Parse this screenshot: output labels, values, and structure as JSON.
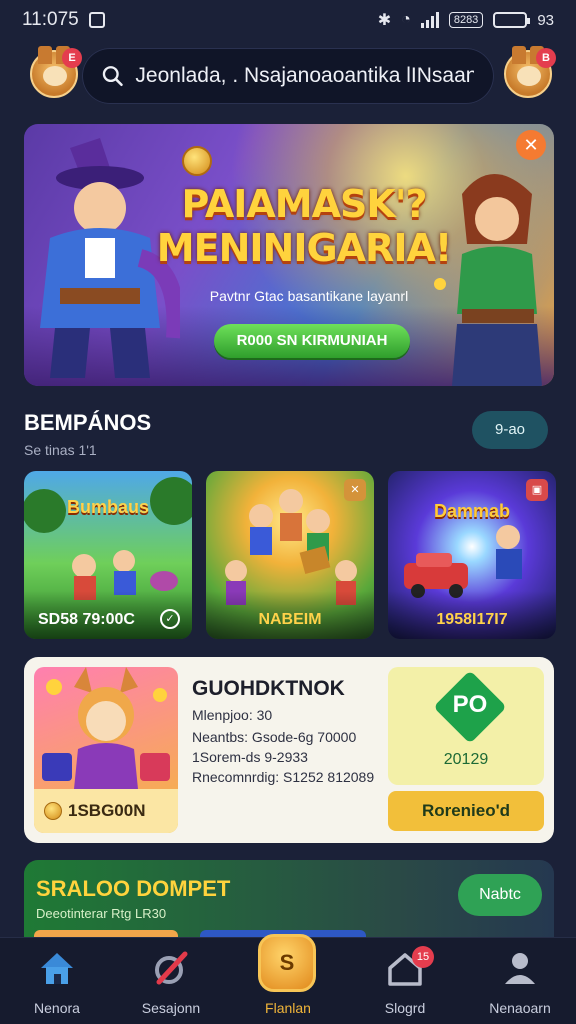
{
  "status_bar": {
    "time": "11:075",
    "battery_label": "8283",
    "battery_percent": "93"
  },
  "header": {
    "search_text": "Jeonlada, . Nsajanoaoantika lINsaan.",
    "left_badge": "E",
    "right_badge": "B"
  },
  "banner": {
    "title_line1": "PAIAMASK'?",
    "title_line2": "MENINIGARIA!",
    "subtitle": "Pavtnr Gtac basantikane layanrl",
    "cta": "R000 SN KIRMUNIAH"
  },
  "section": {
    "title": "BEMPÁNOS",
    "subtitle": "Se tinas 1'1",
    "see_all": "9-ao"
  },
  "games": [
    {
      "name": "Bumbaus",
      "price": "SD58 79:00C"
    },
    {
      "name": "",
      "price": "NABEIM"
    },
    {
      "name": "Dammab",
      "price": "1958I17I7"
    }
  ],
  "promo": {
    "title": "GUOHDKTNOK",
    "line1": "Mlenpjoo: 30",
    "line2": "Neantbs: Gsode-6g 70000",
    "line3": "1Sorem-ds 9-2933",
    "line4": "Rnecomnrdig: S1252 812089",
    "chip_value": "1SBG00N",
    "side_badge": "PO",
    "side_number": "20129",
    "button": "Rorenieo'd"
  },
  "bonus": {
    "title": "SRALOO DOMPET",
    "subtitle": "Deeotinterar Rtg LR30",
    "button": "Nabtc"
  },
  "nav": [
    {
      "label": "Nenora"
    },
    {
      "label": "Sesajonn"
    },
    {
      "label": "Flanlan",
      "icon_text": "S"
    },
    {
      "label": "Slogrd",
      "badge": "15"
    },
    {
      "label": "Nenaoarn"
    }
  ]
}
